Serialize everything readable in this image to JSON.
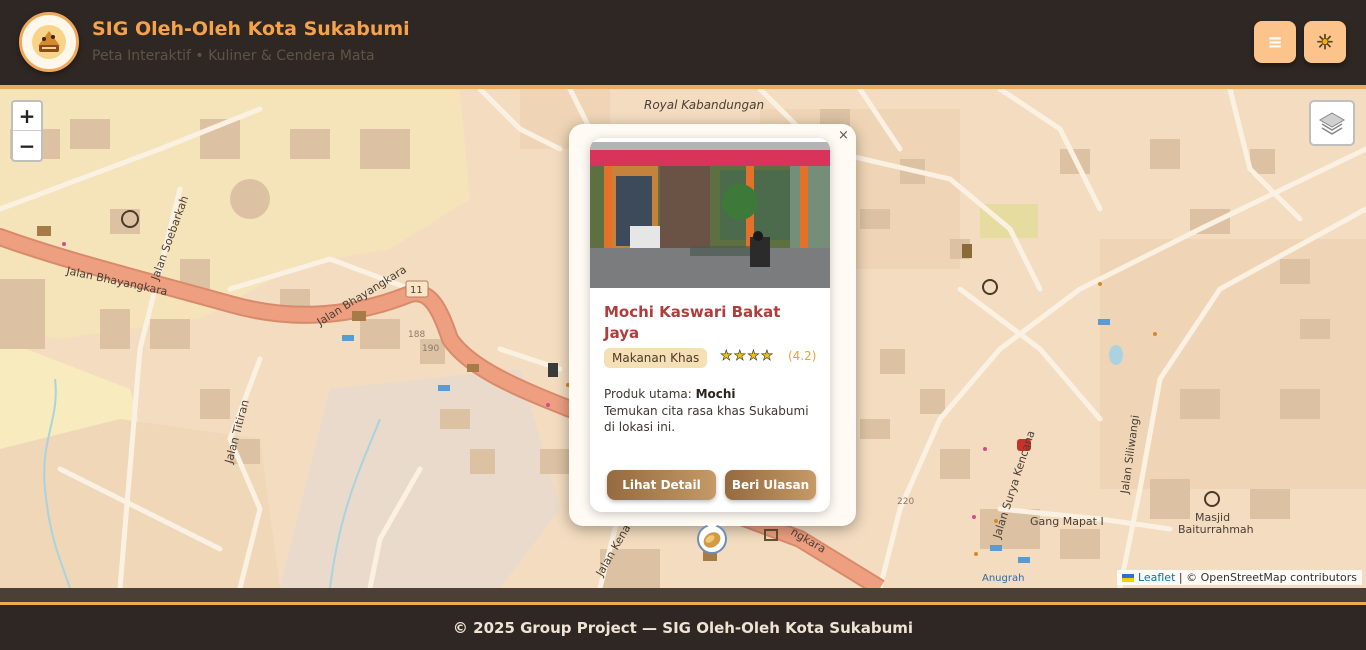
{
  "header": {
    "title": "SIG Oleh-Oleh Kota Sukabumi",
    "subtitle": "Peta Interaktif • Kuliner & Cendera Mata",
    "menu_icon": "hamburger-icon",
    "theme_icon": "sun-icon",
    "menu_glyph": "≡",
    "theme_glyph": "☀"
  },
  "map": {
    "zoom_in": "+",
    "zoom_out": "−",
    "layers_icon": "layers-icon",
    "attribution_leaflet": "Leaflet",
    "attribution_rest": " | © OpenStreetMap contributors",
    "labels": {
      "royal": "Royal Kabandungan",
      "bhayangkara1": "Jalan Bhayangkara",
      "bhayangkara2": "Jalan Bhayangkara",
      "soebarkah": "Jalan Soebarkah",
      "titiran": "Jalan Titiran",
      "surya_kencana": "Jalan Surya Kencana",
      "siliwangi": "Jalan Siliwangi",
      "gang_mapat": "Gang Mapat I",
      "masjid1": "Masjid",
      "masjid2": "Baiturrahmah",
      "anugrah": "Anugrah",
      "kenari": "Jalan Kenari",
      "ngkara": "ngkara",
      "road11": "11",
      "n188": "188",
      "n190": "190",
      "n220": "220"
    },
    "colors": {
      "land": "#f3dcc0",
      "road": "#fbf1e3",
      "main_road": "#e9967a",
      "building": "#dcc2a3",
      "residential": "#efcfa9",
      "yellow_area": "#f7e8b6",
      "gray_area": "#dedad6",
      "water": "#aad3df"
    }
  },
  "popup": {
    "close": "×",
    "name": "Mochi Kaswari Bakat Jaya",
    "category": "Makanan Khas",
    "stars": "★★★★",
    "rating": "(4.2)",
    "product_label": "Produk utama: ",
    "product": "Mochi",
    "description": "Temukan cita rasa khas Sukabumi di lokasi ini.",
    "detail_button": "Lihat Detail",
    "review_button": "Beri Ulasan",
    "photo_icon": "shop-photo"
  },
  "marker": {
    "icon": "mochi-marker-icon"
  },
  "footer": {
    "text": "© 2025 Group Project — SIG Oleh-Oleh Kota Sukabumi"
  }
}
